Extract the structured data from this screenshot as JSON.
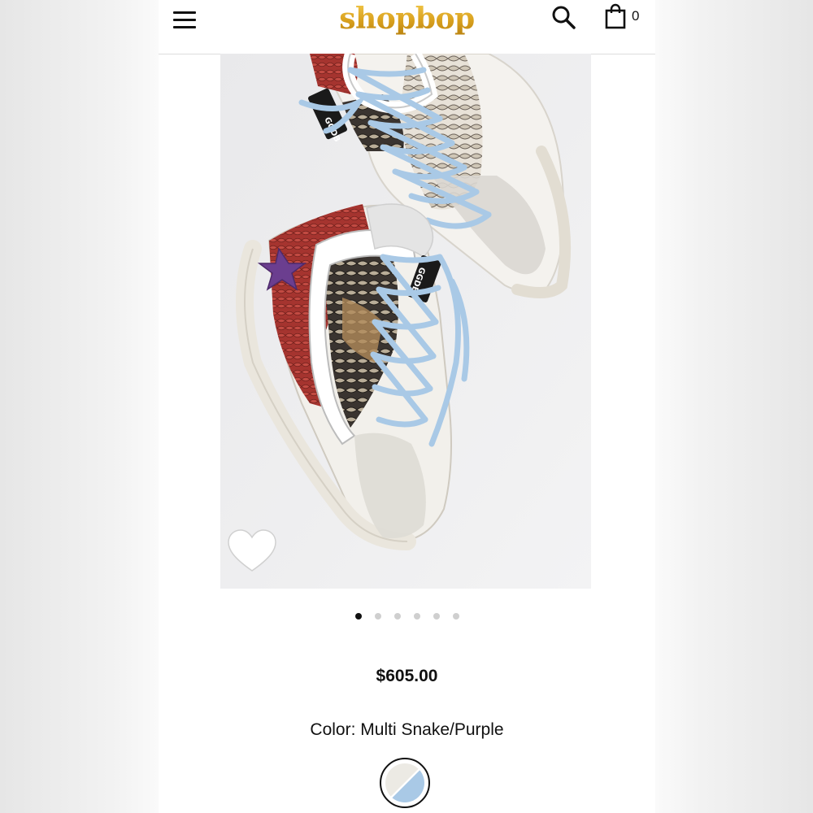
{
  "header": {
    "logo": "shopbop",
    "cart_count": "0"
  },
  "icons": {
    "menu": "hamburger-menu-icon",
    "search": "search-icon",
    "bag": "shopping-bag-icon",
    "favorite": "heart-icon"
  },
  "gallery": {
    "image_alt": "Multi Snake/Purple high-top sneakers",
    "total_images": 6,
    "active_index": 0
  },
  "product": {
    "price": "$605.00",
    "color_label": "Color:",
    "color_value": "Multi Snake/Purple"
  },
  "colors": {
    "brand_gold": "#d9a11e",
    "text": "#111111",
    "lace_blue": "#a9c9e6",
    "accent_purple": "#6b3e8f",
    "accent_red": "#a5342f"
  }
}
